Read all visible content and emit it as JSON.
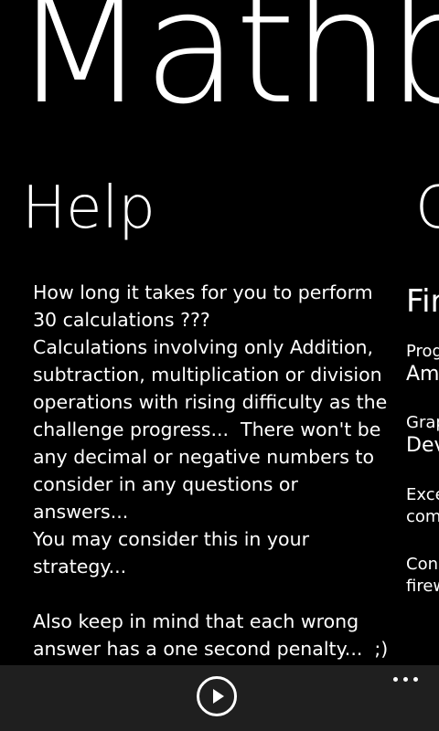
{
  "app": {
    "title": "Mathb"
  },
  "help": {
    "header": "Help",
    "body": "How long it takes for you to perform\n30 calculations ???\nCalculations involving only Addition,\nsubtraction, multiplication or division\noperations with rising difficulty as the\nchallenge progress...  There won't be\nany decimal or negative numbers to\nconsider in any questions or answers...\nYou may consider this in your\nstrategy...\n\nAlso keep in mind that each wrong\nanswer has a one second penalty...  ;)"
  },
  "credits": {
    "header": "C",
    "title": "Fir",
    "items": [
      {
        "label": "Prog",
        "value": "Am"
      },
      {
        "label": "Grap",
        "value": "Dev"
      }
    ],
    "notes": [
      {
        "line1": "Exce",
        "line2": "com"
      },
      {
        "line1": "Con",
        "line2": "firew"
      }
    ]
  },
  "app_bar": {
    "play_icon": "play-icon",
    "more_icon": "ellipsis-icon"
  }
}
